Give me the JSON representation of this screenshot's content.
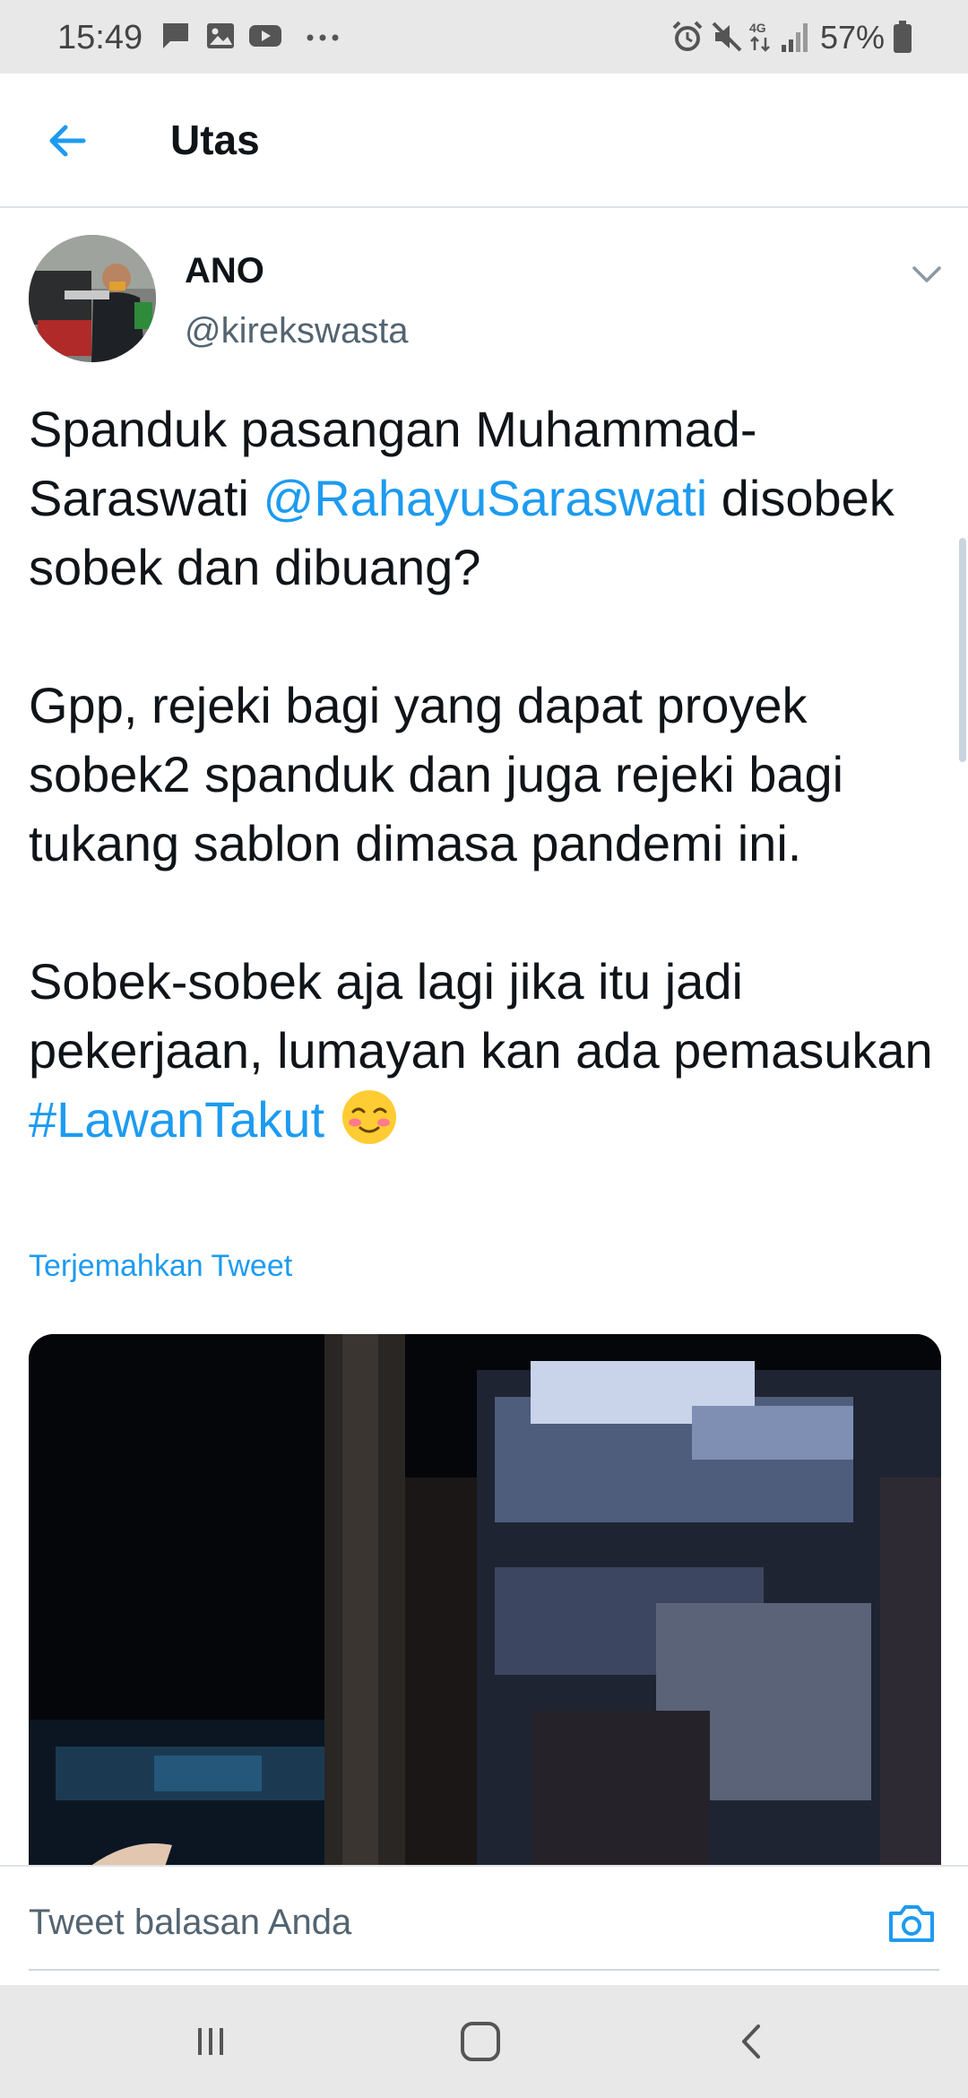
{
  "status_bar": {
    "time": "15:49",
    "battery_percent": "57%",
    "left_icons": [
      "message-icon",
      "image-icon",
      "youtube-icon",
      "more-dots-icon"
    ],
    "right_icons": [
      "alarm-icon",
      "mute-icon",
      "4g-icon",
      "signal-icon",
      "battery-icon"
    ]
  },
  "header": {
    "title": "Utas",
    "back_icon": "arrow-left-icon"
  },
  "tweet": {
    "author_name": "ANO",
    "author_handle": "@kirekswasta",
    "paragraph_1_text": "Spanduk pasangan Muhammad-Saraswati",
    "mention": "@RahayuSaraswati",
    "paragraph_1_rest": "disobek sobek dan dibuang?",
    "paragraph_2": "Gpp, rejeki bagi yang dapat proyek sobek2 spanduk dan juga rejeki bagi tukang sablon dimasa pandemi ini.",
    "paragraph_3_text": "Sobek-sobek aja lagi jika itu jadi pekerjaan, lumayan kan ada pemasukan",
    "hashtag": "#LawanTakut",
    "emoji": "smiling-face-with-blush-emoji",
    "translate_label": "Terjemahkan Tweet"
  },
  "reply_bar": {
    "placeholder": "Tweet balasan Anda",
    "camera_icon": "camera-icon"
  },
  "nav_bar": {
    "buttons": [
      "recent-apps-icon",
      "home-icon",
      "back-icon"
    ]
  },
  "colors": {
    "accent": "#1d9bf0",
    "text": "#0f1419",
    "secondary_text": "#536471",
    "system_bar": "#e8e8e8"
  }
}
